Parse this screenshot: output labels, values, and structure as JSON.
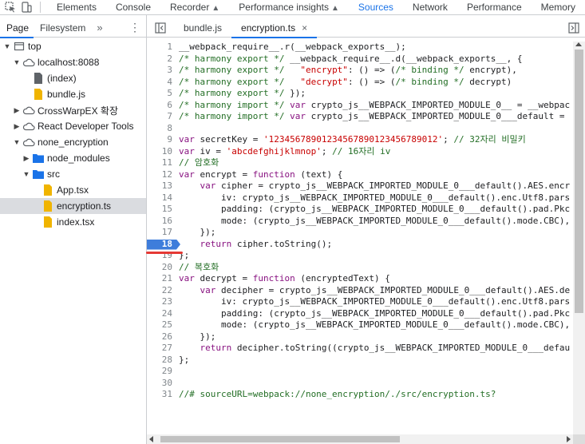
{
  "topbar": {
    "tabs": [
      {
        "label": "Elements"
      },
      {
        "label": "Console"
      },
      {
        "label": "Recorder"
      },
      {
        "label": "Performance insights"
      },
      {
        "label": "Sources"
      },
      {
        "label": "Network"
      },
      {
        "label": "Performance"
      },
      {
        "label": "Memory"
      }
    ]
  },
  "navigator": {
    "tabs": [
      {
        "label": "Page"
      },
      {
        "label": "Filesystem"
      }
    ],
    "more_label": "»",
    "kebab_label": "⋮",
    "tree": [
      {
        "label": "top"
      },
      {
        "label": "localhost:8088"
      },
      {
        "label": "(index)"
      },
      {
        "label": "bundle.js"
      },
      {
        "label": "CrossWarpEX 확장"
      },
      {
        "label": "React Developer Tools"
      },
      {
        "label": "none_encryption"
      },
      {
        "label": "node_modules"
      },
      {
        "label": "src"
      },
      {
        "label": "App.tsx"
      },
      {
        "label": "encryption.ts"
      },
      {
        "label": "index.tsx"
      }
    ]
  },
  "editor": {
    "tabs": [
      {
        "label": "bundle.js"
      },
      {
        "label": "encryption.ts",
        "close": "×"
      }
    ],
    "breakpoint_line": 18,
    "lines": [
      {
        "n": "1",
        "t": "__webpack_require__.r(__webpack_exports__);"
      },
      {
        "n": "2",
        "t": "/* harmony export */ __webpack_require__.d(__webpack_exports__, {"
      },
      {
        "n": "3",
        "t": "/* harmony export */   \"encrypt\": () => (/* binding */ encrypt),"
      },
      {
        "n": "4",
        "t": "/* harmony export */   \"decrypt\": () => (/* binding */ decrypt)"
      },
      {
        "n": "5",
        "t": "/* harmony export */ });"
      },
      {
        "n": "6",
        "t": "/* harmony import */ var crypto_js__WEBPACK_IMPORTED_MODULE_0__ = __webpac"
      },
      {
        "n": "7",
        "t": "/* harmony import */ var crypto_js__WEBPACK_IMPORTED_MODULE_0___default ="
      },
      {
        "n": "8",
        "t": ""
      },
      {
        "n": "9",
        "t": "var secretKey = '12345678901234567890123456789012'; // 32자리 비밀키"
      },
      {
        "n": "10",
        "t": "var iv = 'abcdefghijklmnop'; // 16자리 iv"
      },
      {
        "n": "11",
        "t": "// 암호화"
      },
      {
        "n": "12",
        "t": "var encrypt = function (text) {"
      },
      {
        "n": "13",
        "t": "    var cipher = crypto_js__WEBPACK_IMPORTED_MODULE_0___default().AES.encr"
      },
      {
        "n": "14",
        "t": "        iv: crypto_js__WEBPACK_IMPORTED_MODULE_0___default().enc.Utf8.pars"
      },
      {
        "n": "15",
        "t": "        padding: (crypto_js__WEBPACK_IMPORTED_MODULE_0___default().pad.Pkc"
      },
      {
        "n": "16",
        "t": "        mode: (crypto_js__WEBPACK_IMPORTED_MODULE_0___default().mode.CBC),"
      },
      {
        "n": "17",
        "t": "    });"
      },
      {
        "n": "18",
        "t": "    return cipher.toString();"
      },
      {
        "n": "19",
        "t": "};"
      },
      {
        "n": "20",
        "t": "// 복호화"
      },
      {
        "n": "21",
        "t": "var decrypt = function (encryptedText) {"
      },
      {
        "n": "22",
        "t": "    var decipher = crypto_js__WEBPACK_IMPORTED_MODULE_0___default().AES.de"
      },
      {
        "n": "23",
        "t": "        iv: crypto_js__WEBPACK_IMPORTED_MODULE_0___default().enc.Utf8.pars"
      },
      {
        "n": "24",
        "t": "        padding: (crypto_js__WEBPACK_IMPORTED_MODULE_0___default().pad.Pkc"
      },
      {
        "n": "25",
        "t": "        mode: (crypto_js__WEBPACK_IMPORTED_MODULE_0___default().mode.CBC),"
      },
      {
        "n": "26",
        "t": "    });"
      },
      {
        "n": "27",
        "t": "    return decipher.toString((crypto_js__WEBPACK_IMPORTED_MODULE_0___defau"
      },
      {
        "n": "28",
        "t": "};"
      },
      {
        "n": "29",
        "t": ""
      },
      {
        "n": "30",
        "t": ""
      },
      {
        "n": "31",
        "t": "//# sourceURL=webpack://none_encryption/./src/encryption.ts?"
      }
    ]
  },
  "colors": {
    "accent": "#1a73e8",
    "breakpoint": "#3e7ddb",
    "folder": "#1a73e8",
    "file_js": "#f0b400",
    "comment": "#236e25",
    "keyword": "#881280",
    "string": "#c80000"
  }
}
